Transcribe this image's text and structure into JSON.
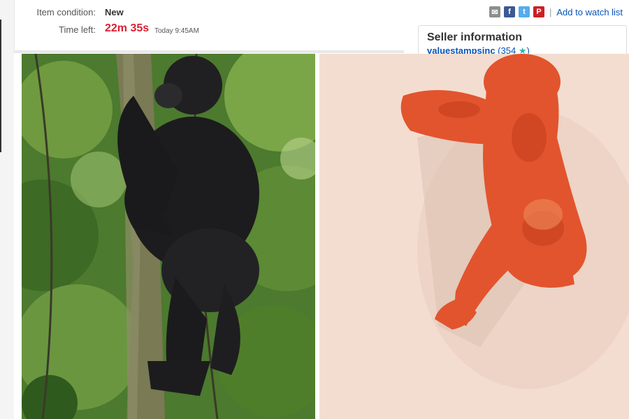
{
  "item": {
    "condition_label": "Item condition:",
    "condition_value": "New",
    "time_left_label": "Time left:",
    "time_left_value": "22m 35s",
    "time_left_end": "Today 9:45AM"
  },
  "share": {
    "icons": [
      "mail-icon",
      "facebook-icon",
      "twitter-icon",
      "pinterest-icon"
    ],
    "separator": "|",
    "watch_label": "Add to watch list"
  },
  "seller": {
    "title": "Seller information",
    "name": "valuestampsinc",
    "score": "(354",
    "score_close": ")"
  },
  "colors": {
    "time_left": "#dd1e31",
    "link": "#0654ba",
    "star": "#2bb5a7"
  }
}
